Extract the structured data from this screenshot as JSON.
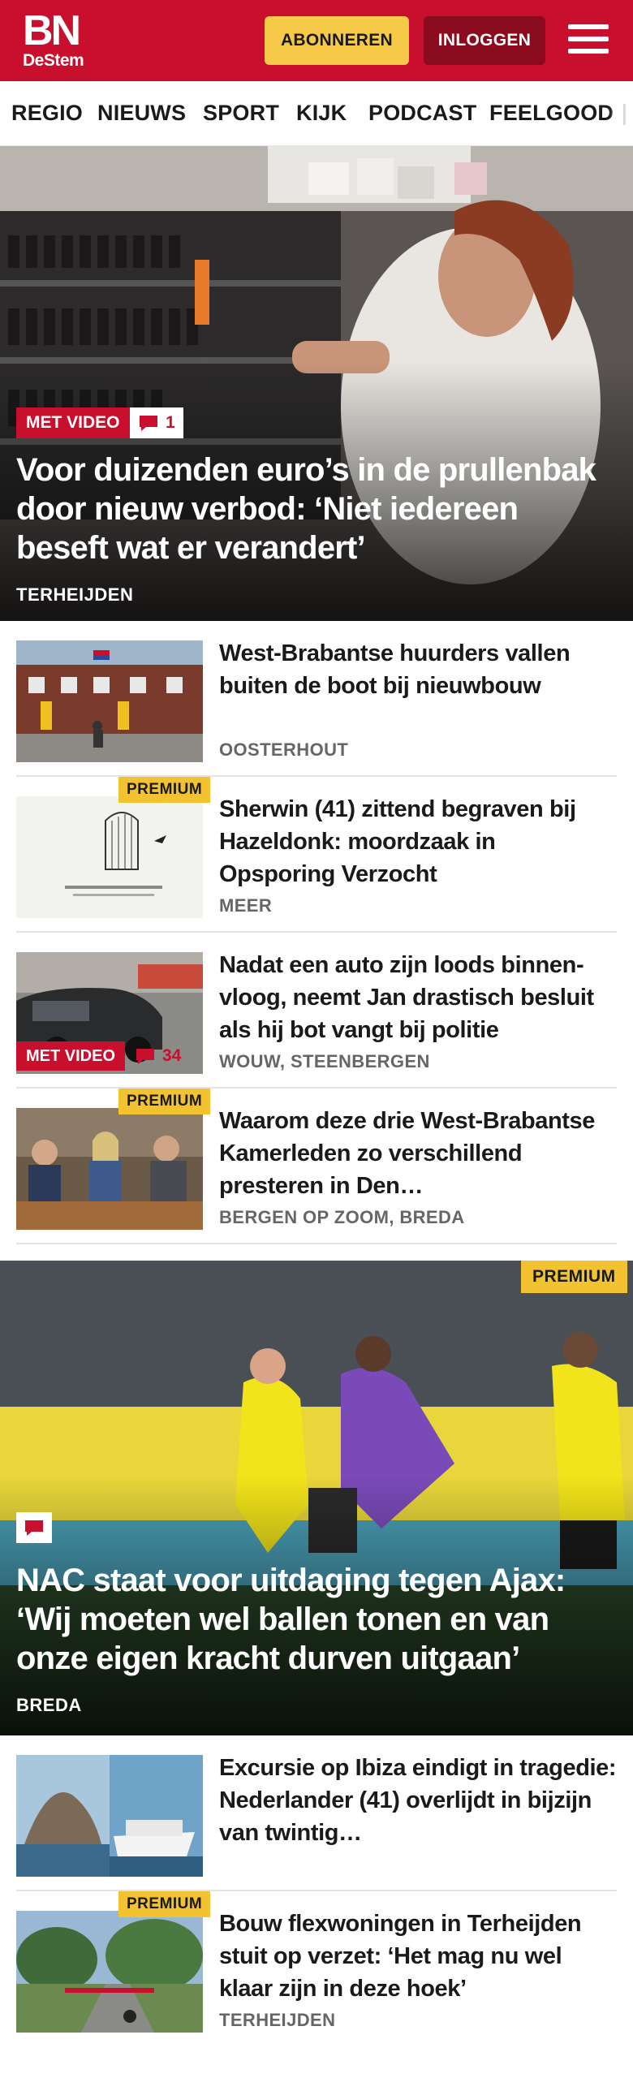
{
  "header": {
    "logo_main": "BN",
    "logo_sub": "DeStem",
    "subscribe_label": "ABONNEREN",
    "login_label": "INLOGGEN",
    "menu_icon": "hamburger-icon",
    "brand_color": "#c8102e",
    "subscribe_color": "#f7c948"
  },
  "nav": {
    "items": [
      "REGIO",
      "NIEUWS",
      "SPORT",
      "KIJK",
      "PODCAST",
      "FEELGOOD"
    ]
  },
  "hero": {
    "video_badge": "MET VIDEO",
    "comment_count": "1",
    "title": "Voor duizenden euro’s in de prullenbak door nieuw verbod: ‘Niet iedereen beseft wat er verandert’",
    "location": "TERHEIJDEN"
  },
  "articles": [
    {
      "title": "West-Brabantse huurders vallen buiten de boot bij nieuwbouw",
      "location": "OOSTERHOUT"
    },
    {
      "premium": "PREMIUM",
      "title": "Sherwin (41) zittend begraven bij Hazeldonk: moordzaak in Opsporing Verzocht",
      "location": "MEER"
    },
    {
      "video_badge": "MET VIDEO",
      "comment_count": "34",
      "title": "Nadat een auto zijn loods binnen-vloog, neemt Jan drastisch besluit als hij bot vangt bij politie",
      "location": "WOUW, STEENBERGEN"
    },
    {
      "premium": "PREMIUM",
      "title": "Waarom deze drie West-Brabantse Kamerleden zo verschillend presteren in Den…",
      "location": "BERGEN OP ZOOM, BREDA"
    }
  ],
  "hero2": {
    "premium": "PREMIUM",
    "title": "NAC staat voor uitdaging tegen Ajax: ‘Wij moeten wel ballen tonen en van onze eigen kracht durven uitgaan’",
    "location": "BREDA"
  },
  "articles2": [
    {
      "title": "Excursie op Ibiza eindigt in tragedie: Nederlander (41) overlijdt in bijzijn van twintig…",
      "location": ""
    },
    {
      "premium": "PREMIUM",
      "title": "Bouw flexwoningen in Terheijden stuit op verzet: ‘Het mag nu wel klaar zijn in deze hoek’",
      "location": "TERHEIJDEN"
    }
  ]
}
